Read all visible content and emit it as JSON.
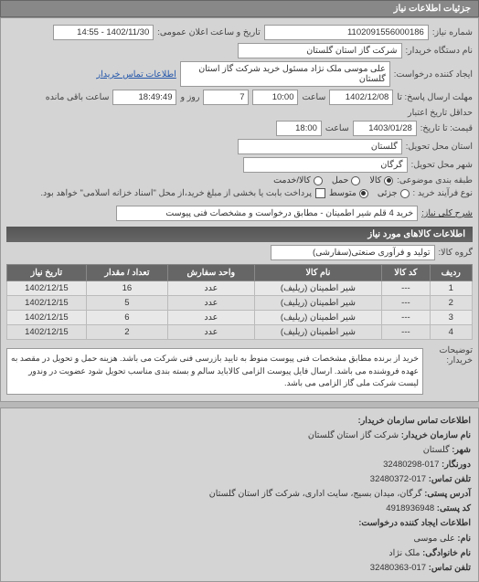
{
  "header": {
    "title": "جزئیات اطلاعات نیاز"
  },
  "fields": {
    "req_no_label": "شماره نیاز:",
    "req_no": "1102091556000186",
    "pub_datetime_label": "تاریخ و ساعت اعلان عمومی:",
    "pub_datetime": "1402/11/30 - 14:55",
    "buyer_name_label": "نام دستگاه خریدار:",
    "buyer_name": "شرکت گاز استان گلستان",
    "creator_label": "ایجاد کننده درخواست:",
    "creator": "علی موسی ملک نژاد مسئول خرید شرکت گاز استان گلستان",
    "buyer_contact_link": "اطلاعات تماس خریدار",
    "send_deadline_label": "مهلت ارسال پاسخ: تا",
    "send_deadline_date": "1402/12/08",
    "time_label": "ساعت",
    "send_deadline_time": "10:00",
    "remaining_days": "7",
    "remaining_days_label": "روز و",
    "remaining_time": "18:49:49",
    "remaining_time_label": "ساعت باقی مانده",
    "history_label": "حداقل تاریخ اعتبار",
    "price_label": "قیمت: تا تاریخ:",
    "price_date": "1403/01/28",
    "price_time": "18:00",
    "province_label": "استان محل تحویل:",
    "province": "گلستان",
    "city_label": "شهر محل تحویل:",
    "city": "گرگان",
    "pkg_label": "طبقه بندی موضوعی:",
    "pkg_opts": [
      "کالا",
      "حمل",
      "کالا/خدمت"
    ],
    "process_label": "نوع فرآیند خرید :",
    "process_opts": [
      "جزئی",
      "متوسط"
    ],
    "process_note": "پرداخت بابت یا بخشی از مبلغ خرید،از محل \"اسناد خزانه اسلامی\" خواهد بود.",
    "desc_label": "شرح کلی نیاز:",
    "desc": "خرید 4 قلم شیر اطمینان - مطابق درخواست و مشخصات فنی پیوست"
  },
  "goods_section": {
    "title": "اطلاعات کالاهای مورد نیاز",
    "group_label": "گروه کالا:",
    "group_value": "تولید و فرآوری صنعتی(سفارشی)",
    "columns": [
      "ردیف",
      "کد کالا",
      "نام کالا",
      "واحد سفارش",
      "تعداد / مقدار",
      "تاریخ نیاز"
    ],
    "rows": [
      {
        "n": "1",
        "code": "---",
        "name": "شیر اطمینان (ریلیف)",
        "unit": "عدد",
        "qty": "16",
        "date": "1402/12/15"
      },
      {
        "n": "2",
        "code": "---",
        "name": "شیر اطمینان (ریلیف)",
        "unit": "عدد",
        "qty": "5",
        "date": "1402/12/15"
      },
      {
        "n": "3",
        "code": "---",
        "name": "شیر اطمینان (ریلیف)",
        "unit": "عدد",
        "qty": "6",
        "date": "1402/12/15"
      },
      {
        "n": "4",
        "code": "---",
        "name": "شیر اطمینان (ریلیف)",
        "unit": "عدد",
        "qty": "2",
        "date": "1402/12/15"
      }
    ],
    "notes_label": "توضیحات خریدار:",
    "notes": "خرید از برنده مطابق مشخصات فنی پیوست منوط به تایید بازرسی فنی شرکت می باشد. هزینه حمل و تحویل در مقصد به عهده فروشنده می باشد. ارسال فایل پیوست الزامی کالاباید سالم و بسته بندی مناسب تحویل شود عضویت در وندور لیست شرکت ملی گاز الزامی می باشد."
  },
  "footer": {
    "title": "اطلاعات تماس سازمان خریدار:",
    "org_label": "نام سازمان خریدار:",
    "org": "شرکت گاز استان گلستان",
    "city_label": "شهر:",
    "city": "گلستان",
    "fax_label": "دورنگار:",
    "fax": "017-32480298",
    "phone_label": "تلفن تماس:",
    "phone": "017-32480372",
    "addr_label": "آدرس پستی:",
    "addr": "گرگان، میدان بسیج، سایت اداری، شرکت گاز استان گلستان",
    "zip_label": "کد پستی:",
    "zip": "4918936948",
    "creator_title": "اطلاعات ایجاد کننده درخواست:",
    "name_label": "نام:",
    "name": "علی موسی",
    "lname_label": "نام خانوادگی:",
    "lname": "ملک نژاد",
    "ph2_label": "تلفن تماس:",
    "ph2": "017-32480363"
  }
}
